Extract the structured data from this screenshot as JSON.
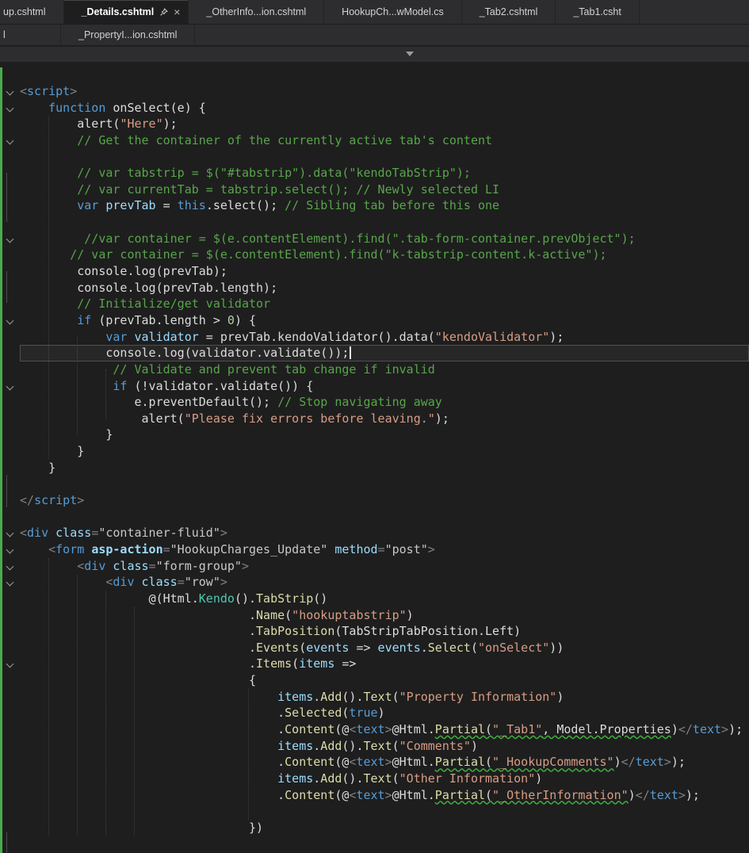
{
  "icons": {
    "close": "×",
    "pin": "pin-icon",
    "dropdown": "chevron-down-icon",
    "fold": "chevron-down-icon"
  },
  "colors": {
    "background": "#1e1e1e",
    "tab_strip": "#2d2d30",
    "active_tab": "#1e1e1e",
    "keyword": "#569cd6",
    "comment": "#57a64a",
    "string": "#d69d85",
    "method": "#dcdcaa",
    "identifier": "#9cdcfe",
    "type": "#4ec9b0",
    "number": "#b5cea8",
    "html_delimiter": "#808080",
    "attr_value": "#c8c8c8",
    "change_bar": "#48ad48",
    "squiggle": "#3fae3f"
  },
  "tab_rows": [
    {
      "tabs": [
        {
          "label": "up.cshtml"
        },
        {
          "label": "_Details.cshtml",
          "active": true,
          "pin": true,
          "close": true
        },
        {
          "label": "_OtherInfo...ion.cshtml"
        },
        {
          "label": "HookupCh...wModel.cs"
        },
        {
          "label": "_Tab2.cshtml"
        },
        {
          "label": "_Tab1.csht"
        }
      ]
    },
    {
      "tabs": [
        {
          "label": "l"
        },
        {
          "label": "_PropertyI...ion.cshtml"
        }
      ]
    }
  ],
  "editor": {
    "cursor_line": 17,
    "lines": [
      {
        "i": 0,
        "f": 1,
        "seg": [
          [
            "d",
            "<"
          ],
          [
            "t",
            "script"
          ],
          [
            "d",
            ">"
          ]
        ]
      },
      {
        "i": 4,
        "f": 1,
        "seg": [
          [
            "k",
            "function"
          ],
          [
            "w",
            " onSelect(e) {"
          ]
        ]
      },
      {
        "i": 8,
        "seg": [
          [
            "w",
            "alert("
          ],
          [
            "s",
            "\"Here\""
          ],
          [
            "w",
            ");"
          ]
        ]
      },
      {
        "i": 8,
        "f": 1,
        "seg": [
          [
            "c",
            "// Get the container of the currently active tab's content"
          ]
        ]
      },
      {
        "i": 0,
        "seg": []
      },
      {
        "i": 8,
        "seg": [
          [
            "c",
            "// var tabstrip = $(\"#tabstrip\").data(\"kendoTabStrip\");"
          ]
        ]
      },
      {
        "i": 8,
        "seg": [
          [
            "c",
            "// var currentTab = tabstrip.select(); // Newly selected LI"
          ]
        ]
      },
      {
        "i": 8,
        "seg": [
          [
            "k",
            "var"
          ],
          [
            "w",
            " "
          ],
          [
            "p",
            "prevTab"
          ],
          [
            "w",
            " = "
          ],
          [
            "k",
            "this"
          ],
          [
            "w",
            ".select(); "
          ],
          [
            "c",
            "// Sibling tab before this one"
          ]
        ]
      },
      {
        "i": 0,
        "seg": []
      },
      {
        "i": 9,
        "f": 1,
        "seg": [
          [
            "c",
            "//var container = $(e.contentElement).find(\".tab-form-container.prevObject\");"
          ]
        ]
      },
      {
        "i": 7,
        "seg": [
          [
            "c",
            "// var container = $(e.contentElement).find(\"k-tabstrip-content.k-active\");"
          ]
        ]
      },
      {
        "i": 8,
        "seg": [
          [
            "w",
            "console.log(prevTab);"
          ]
        ]
      },
      {
        "i": 8,
        "seg": [
          [
            "w",
            "console.log(prevTab.length);"
          ]
        ]
      },
      {
        "i": 8,
        "seg": [
          [
            "c",
            "// Initialize/get validator"
          ]
        ]
      },
      {
        "i": 8,
        "f": 1,
        "seg": [
          [
            "k",
            "if"
          ],
          [
            "w",
            " (prevTab.length > "
          ],
          [
            "n",
            "0"
          ],
          [
            "w",
            ") {"
          ]
        ]
      },
      {
        "i": 12,
        "seg": [
          [
            "k",
            "var"
          ],
          [
            "w",
            " "
          ],
          [
            "p",
            "validator"
          ],
          [
            "w",
            " = prevTab.kendoValidator().data("
          ],
          [
            "s",
            "\"kendoValidator\""
          ],
          [
            "w",
            ");"
          ]
        ]
      },
      {
        "i": 12,
        "seg": [
          [
            "w",
            "console.log(validator.validate());"
          ]
        ]
      },
      {
        "i": 13,
        "seg": [
          [
            "c",
            "// Validate and prevent tab change if invalid"
          ]
        ]
      },
      {
        "i": 13,
        "f": 1,
        "seg": [
          [
            "k",
            "if"
          ],
          [
            "w",
            " (!validator.validate()) {"
          ]
        ]
      },
      {
        "i": 16,
        "seg": [
          [
            "w",
            "e.preventDefault(); "
          ],
          [
            "c",
            "// Stop navigating away"
          ]
        ]
      },
      {
        "i": 17,
        "seg": [
          [
            "w",
            "alert("
          ],
          [
            "s",
            "\"Please fix errors before leaving.\""
          ],
          [
            "w",
            ");"
          ]
        ]
      },
      {
        "i": 12,
        "seg": [
          [
            "w",
            "}"
          ]
        ]
      },
      {
        "i": 8,
        "seg": [
          [
            "w",
            "}"
          ]
        ]
      },
      {
        "i": 4,
        "seg": [
          [
            "w",
            "}"
          ]
        ]
      },
      {
        "i": 0,
        "seg": []
      },
      {
        "i": 0,
        "seg": [
          [
            "d",
            "</"
          ],
          [
            "t",
            "script"
          ],
          [
            "d",
            ">"
          ]
        ]
      },
      {
        "i": 0,
        "seg": []
      },
      {
        "i": 0,
        "f": 1,
        "seg": [
          [
            "d",
            "<"
          ],
          [
            "t",
            "div"
          ],
          [
            "w",
            " "
          ],
          [
            "a",
            "class"
          ],
          [
            "d",
            "="
          ],
          [
            "v",
            "\"container-fluid\""
          ],
          [
            "d",
            ">"
          ]
        ]
      },
      {
        "i": 4,
        "f": 1,
        "seg": [
          [
            "d",
            "<"
          ],
          [
            "t",
            "form"
          ],
          [
            "w",
            " "
          ],
          [
            "ab",
            "asp-action"
          ],
          [
            "d",
            "="
          ],
          [
            "v",
            "\"HookupCharges_Update\""
          ],
          [
            "w",
            " "
          ],
          [
            "a",
            "method"
          ],
          [
            "d",
            "="
          ],
          [
            "v",
            "\"post\""
          ],
          [
            "d",
            ">"
          ]
        ]
      },
      {
        "i": 8,
        "f": 1,
        "seg": [
          [
            "d",
            "<"
          ],
          [
            "t",
            "div"
          ],
          [
            "w",
            " "
          ],
          [
            "a",
            "class"
          ],
          [
            "d",
            "="
          ],
          [
            "v",
            "\"form-group\""
          ],
          [
            "d",
            ">"
          ]
        ]
      },
      {
        "i": 12,
        "f": 1,
        "seg": [
          [
            "d",
            "<"
          ],
          [
            "t",
            "div"
          ],
          [
            "w",
            " "
          ],
          [
            "a",
            "class"
          ],
          [
            "d",
            "="
          ],
          [
            "v",
            "\"row\""
          ],
          [
            "d",
            ">"
          ]
        ]
      },
      {
        "i": 18,
        "seg": [
          [
            "w",
            "@(Html."
          ],
          [
            "ty",
            "Kendo"
          ],
          [
            "w",
            "()."
          ],
          [
            "m",
            "TabStrip"
          ],
          [
            "w",
            "()"
          ]
        ]
      },
      {
        "i": 32,
        "seg": [
          [
            "w",
            "."
          ],
          [
            "m",
            "Name"
          ],
          [
            "w",
            "("
          ],
          [
            "s",
            "\"hookuptabstrip\""
          ],
          [
            "w",
            ")"
          ]
        ]
      },
      {
        "i": 32,
        "seg": [
          [
            "w",
            "."
          ],
          [
            "m",
            "TabPosition"
          ],
          [
            "w",
            "(TabStripTabPosition.Left)"
          ]
        ]
      },
      {
        "i": 32,
        "seg": [
          [
            "w",
            "."
          ],
          [
            "m",
            "Events"
          ],
          [
            "w",
            "("
          ],
          [
            "p",
            "events"
          ],
          [
            "w",
            " => "
          ],
          [
            "p",
            "events"
          ],
          [
            "w",
            "."
          ],
          [
            "m",
            "Select"
          ],
          [
            "w",
            "("
          ],
          [
            "s",
            "\"onSelect\""
          ],
          [
            "w",
            "))"
          ]
        ]
      },
      {
        "i": 32,
        "f": 1,
        "seg": [
          [
            "w",
            "."
          ],
          [
            "m",
            "Items"
          ],
          [
            "w",
            "("
          ],
          [
            "p",
            "items"
          ],
          [
            "w",
            " =>"
          ]
        ]
      },
      {
        "i": 32,
        "seg": [
          [
            "w",
            "{"
          ]
        ]
      },
      {
        "i": 36,
        "seg": [
          [
            "p",
            "items"
          ],
          [
            "w",
            "."
          ],
          [
            "m",
            "Add"
          ],
          [
            "w",
            "()."
          ],
          [
            "m",
            "Text"
          ],
          [
            "w",
            "("
          ],
          [
            "s",
            "\"Property Information\""
          ],
          [
            "w",
            ")"
          ]
        ]
      },
      {
        "i": 36,
        "seg": [
          [
            "w",
            "."
          ],
          [
            "m",
            "Selected"
          ],
          [
            "w",
            "("
          ],
          [
            "k",
            "true"
          ],
          [
            "w",
            ")"
          ]
        ]
      },
      {
        "i": 36,
        "seg": [
          [
            "w",
            "."
          ],
          [
            "m",
            "Content"
          ],
          [
            "w",
            "(@"
          ],
          [
            "d",
            "<"
          ],
          [
            "t",
            "text"
          ],
          [
            "d",
            ">"
          ],
          [
            "w",
            "@Html."
          ],
          [
            "m",
            "Partial",
            1
          ],
          [
            "w",
            "(",
            1
          ],
          [
            "s",
            "\"_Tab1\"",
            1
          ],
          [
            "w",
            ", Model.Properties",
            1
          ],
          [
            "w",
            ")"
          ],
          [
            "d",
            "</"
          ],
          [
            "t",
            "text"
          ],
          [
            "d",
            ">"
          ],
          [
            "w",
            ");"
          ]
        ]
      },
      {
        "i": 36,
        "seg": [
          [
            "p",
            "items"
          ],
          [
            "w",
            "."
          ],
          [
            "m",
            "Add"
          ],
          [
            "w",
            "()."
          ],
          [
            "m",
            "Text"
          ],
          [
            "w",
            "("
          ],
          [
            "s",
            "\"Comments\""
          ],
          [
            "w",
            ")"
          ]
        ]
      },
      {
        "i": 36,
        "seg": [
          [
            "w",
            "."
          ],
          [
            "m",
            "Content"
          ],
          [
            "w",
            "(@"
          ],
          [
            "d",
            "<"
          ],
          [
            "t",
            "text"
          ],
          [
            "d",
            ">"
          ],
          [
            "w",
            "@Html."
          ],
          [
            "m",
            "Partial",
            1
          ],
          [
            "w",
            "(",
            1
          ],
          [
            "s",
            "\"_HookupComments\"",
            1
          ],
          [
            "w",
            ")"
          ],
          [
            "d",
            "</"
          ],
          [
            "t",
            "text"
          ],
          [
            "d",
            ">"
          ],
          [
            "w",
            ");"
          ]
        ]
      },
      {
        "i": 36,
        "seg": [
          [
            "p",
            "items"
          ],
          [
            "w",
            "."
          ],
          [
            "m",
            "Add"
          ],
          [
            "w",
            "()."
          ],
          [
            "m",
            "Text"
          ],
          [
            "w",
            "("
          ],
          [
            "s",
            "\"Other Information\""
          ],
          [
            "w",
            ")"
          ]
        ]
      },
      {
        "i": 36,
        "seg": [
          [
            "w",
            "."
          ],
          [
            "m",
            "Content"
          ],
          [
            "w",
            "(@"
          ],
          [
            "d",
            "<"
          ],
          [
            "t",
            "text"
          ],
          [
            "d",
            ">"
          ],
          [
            "w",
            "@Html."
          ],
          [
            "m",
            "Partial",
            1
          ],
          [
            "w",
            "(",
            1
          ],
          [
            "s",
            "\"_OtherInformation\"",
            1
          ],
          [
            "w",
            ")"
          ],
          [
            "d",
            "</"
          ],
          [
            "t",
            "text"
          ],
          [
            "d",
            ">"
          ],
          [
            "w",
            ");"
          ]
        ]
      },
      {
        "i": 0,
        "seg": []
      },
      {
        "i": 32,
        "seg": [
          [
            "w",
            "})"
          ]
        ]
      }
    ]
  }
}
